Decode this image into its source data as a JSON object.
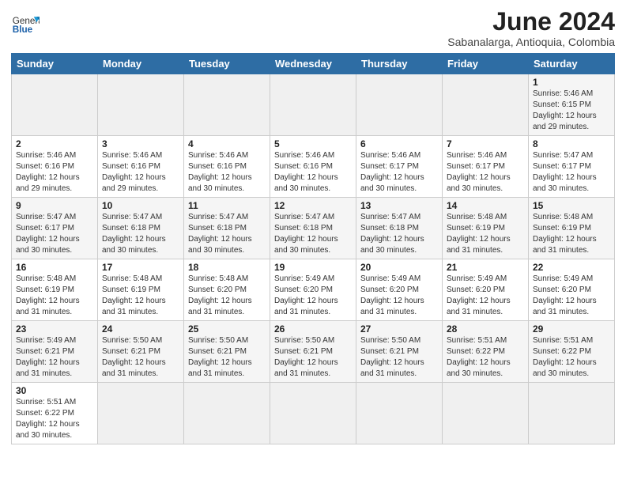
{
  "logo": {
    "text_normal": "General",
    "text_bold": "Blue"
  },
  "title": "June 2024",
  "subtitle": "Sabanalarga, Antioquia, Colombia",
  "days_of_week": [
    "Sunday",
    "Monday",
    "Tuesday",
    "Wednesday",
    "Thursday",
    "Friday",
    "Saturday"
  ],
  "weeks": [
    [
      {
        "day": "",
        "info": ""
      },
      {
        "day": "",
        "info": ""
      },
      {
        "day": "",
        "info": ""
      },
      {
        "day": "",
        "info": ""
      },
      {
        "day": "",
        "info": ""
      },
      {
        "day": "",
        "info": ""
      },
      {
        "day": "1",
        "info": "Sunrise: 5:46 AM\nSunset: 6:15 PM\nDaylight: 12 hours and 29 minutes."
      }
    ],
    [
      {
        "day": "2",
        "info": "Sunrise: 5:46 AM\nSunset: 6:16 PM\nDaylight: 12 hours and 29 minutes."
      },
      {
        "day": "3",
        "info": "Sunrise: 5:46 AM\nSunset: 6:16 PM\nDaylight: 12 hours and 29 minutes."
      },
      {
        "day": "4",
        "info": "Sunrise: 5:46 AM\nSunset: 6:16 PM\nDaylight: 12 hours and 30 minutes."
      },
      {
        "day": "5",
        "info": "Sunrise: 5:46 AM\nSunset: 6:16 PM\nDaylight: 12 hours and 30 minutes."
      },
      {
        "day": "6",
        "info": "Sunrise: 5:46 AM\nSunset: 6:17 PM\nDaylight: 12 hours and 30 minutes."
      },
      {
        "day": "7",
        "info": "Sunrise: 5:46 AM\nSunset: 6:17 PM\nDaylight: 12 hours and 30 minutes."
      },
      {
        "day": "8",
        "info": "Sunrise: 5:47 AM\nSunset: 6:17 PM\nDaylight: 12 hours and 30 minutes."
      }
    ],
    [
      {
        "day": "9",
        "info": "Sunrise: 5:47 AM\nSunset: 6:17 PM\nDaylight: 12 hours and 30 minutes."
      },
      {
        "day": "10",
        "info": "Sunrise: 5:47 AM\nSunset: 6:18 PM\nDaylight: 12 hours and 30 minutes."
      },
      {
        "day": "11",
        "info": "Sunrise: 5:47 AM\nSunset: 6:18 PM\nDaylight: 12 hours and 30 minutes."
      },
      {
        "day": "12",
        "info": "Sunrise: 5:47 AM\nSunset: 6:18 PM\nDaylight: 12 hours and 30 minutes."
      },
      {
        "day": "13",
        "info": "Sunrise: 5:47 AM\nSunset: 6:18 PM\nDaylight: 12 hours and 30 minutes."
      },
      {
        "day": "14",
        "info": "Sunrise: 5:48 AM\nSunset: 6:19 PM\nDaylight: 12 hours and 31 minutes."
      },
      {
        "day": "15",
        "info": "Sunrise: 5:48 AM\nSunset: 6:19 PM\nDaylight: 12 hours and 31 minutes."
      }
    ],
    [
      {
        "day": "16",
        "info": "Sunrise: 5:48 AM\nSunset: 6:19 PM\nDaylight: 12 hours and 31 minutes."
      },
      {
        "day": "17",
        "info": "Sunrise: 5:48 AM\nSunset: 6:19 PM\nDaylight: 12 hours and 31 minutes."
      },
      {
        "day": "18",
        "info": "Sunrise: 5:48 AM\nSunset: 6:20 PM\nDaylight: 12 hours and 31 minutes."
      },
      {
        "day": "19",
        "info": "Sunrise: 5:49 AM\nSunset: 6:20 PM\nDaylight: 12 hours and 31 minutes."
      },
      {
        "day": "20",
        "info": "Sunrise: 5:49 AM\nSunset: 6:20 PM\nDaylight: 12 hours and 31 minutes."
      },
      {
        "day": "21",
        "info": "Sunrise: 5:49 AM\nSunset: 6:20 PM\nDaylight: 12 hours and 31 minutes."
      },
      {
        "day": "22",
        "info": "Sunrise: 5:49 AM\nSunset: 6:20 PM\nDaylight: 12 hours and 31 minutes."
      }
    ],
    [
      {
        "day": "23",
        "info": "Sunrise: 5:49 AM\nSunset: 6:21 PM\nDaylight: 12 hours and 31 minutes."
      },
      {
        "day": "24",
        "info": "Sunrise: 5:50 AM\nSunset: 6:21 PM\nDaylight: 12 hours and 31 minutes."
      },
      {
        "day": "25",
        "info": "Sunrise: 5:50 AM\nSunset: 6:21 PM\nDaylight: 12 hours and 31 minutes."
      },
      {
        "day": "26",
        "info": "Sunrise: 5:50 AM\nSunset: 6:21 PM\nDaylight: 12 hours and 31 minutes."
      },
      {
        "day": "27",
        "info": "Sunrise: 5:50 AM\nSunset: 6:21 PM\nDaylight: 12 hours and 31 minutes."
      },
      {
        "day": "28",
        "info": "Sunrise: 5:51 AM\nSunset: 6:22 PM\nDaylight: 12 hours and 30 minutes."
      },
      {
        "day": "29",
        "info": "Sunrise: 5:51 AM\nSunset: 6:22 PM\nDaylight: 12 hours and 30 minutes."
      }
    ],
    [
      {
        "day": "30",
        "info": "Sunrise: 5:51 AM\nSunset: 6:22 PM\nDaylight: 12 hours and 30 minutes."
      },
      {
        "day": "",
        "info": ""
      },
      {
        "day": "",
        "info": ""
      },
      {
        "day": "",
        "info": ""
      },
      {
        "day": "",
        "info": ""
      },
      {
        "day": "",
        "info": ""
      },
      {
        "day": "",
        "info": ""
      }
    ]
  ]
}
